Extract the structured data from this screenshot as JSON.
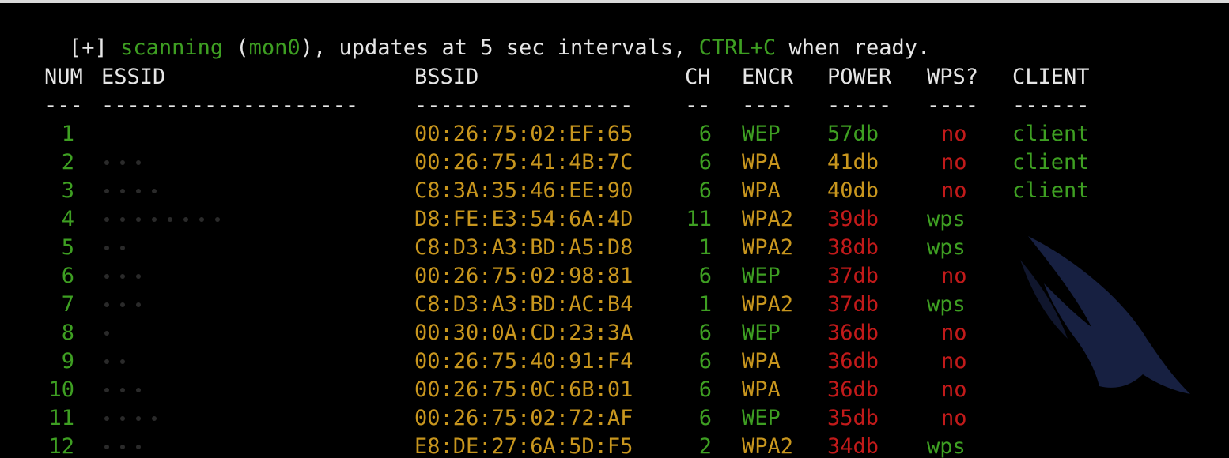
{
  "status_line": {
    "prefix": "[+]",
    "word_scanning": "scanning",
    "iface_open": "(",
    "iface": "mon0",
    "mid": "), updates at 5 sec intervals,",
    "ctrl_c": "CTRL+C",
    "suffix": "when ready."
  },
  "table": {
    "headers": {
      "num": "NUM",
      "essid": "ESSID",
      "bssid": "BSSID",
      "ch": "CH",
      "encr": "ENCR",
      "power": "POWER",
      "wps": "WPS?",
      "client": "CLIENT"
    },
    "separators": {
      "num": "---",
      "essid": "--------------------",
      "bssid": "-----------------",
      "ch": "--",
      "encr": "----",
      "power": "-----",
      "wps": "----",
      "client": "------"
    },
    "rows": [
      {
        "num": "1",
        "bssid": "00:26:75:02:EF:65",
        "ch": "6",
        "encr": "WEP",
        "power": "57db",
        "power_level": "high",
        "wps": "no",
        "client": "client"
      },
      {
        "num": "2",
        "bssid": "00:26:75:41:4B:7C",
        "ch": "6",
        "encr": "WPA",
        "power": "41db",
        "power_level": "mid",
        "wps": "no",
        "client": "client"
      },
      {
        "num": "3",
        "bssid": "C8:3A:35:46:EE:90",
        "ch": "6",
        "encr": "WPA",
        "power": "40db",
        "power_level": "mid",
        "wps": "no",
        "client": "client"
      },
      {
        "num": "4",
        "bssid": "D8:FE:E3:54:6A:4D",
        "ch": "11",
        "encr": "WPA2",
        "power": "39db",
        "power_level": "low",
        "wps": "wps",
        "client": ""
      },
      {
        "num": "5",
        "bssid": "C8:D3:A3:BD:A5:D8",
        "ch": "1",
        "encr": "WPA2",
        "power": "38db",
        "power_level": "low",
        "wps": "wps",
        "client": ""
      },
      {
        "num": "6",
        "bssid": "00:26:75:02:98:81",
        "ch": "6",
        "encr": "WEP",
        "power": "37db",
        "power_level": "low",
        "wps": "no",
        "client": ""
      },
      {
        "num": "7",
        "bssid": "C8:D3:A3:BD:AC:B4",
        "ch": "1",
        "encr": "WPA2",
        "power": "37db",
        "power_level": "low",
        "wps": "wps",
        "client": ""
      },
      {
        "num": "8",
        "bssid": "00:30:0A:CD:23:3A",
        "ch": "6",
        "encr": "WEP",
        "power": "36db",
        "power_level": "low",
        "wps": "no",
        "client": ""
      },
      {
        "num": "9",
        "bssid": "00:26:75:40:91:F4",
        "ch": "6",
        "encr": "WPA",
        "power": "36db",
        "power_level": "low",
        "wps": "no",
        "client": ""
      },
      {
        "num": "10",
        "bssid": "00:26:75:0C:6B:01",
        "ch": "6",
        "encr": "WPA",
        "power": "36db",
        "power_level": "low",
        "wps": "no",
        "client": ""
      },
      {
        "num": "11",
        "bssid": "00:26:75:02:72:AF",
        "ch": "6",
        "encr": "WEP",
        "power": "35db",
        "power_level": "low",
        "wps": "no",
        "client": ""
      },
      {
        "num": "12",
        "bssid": "E8:DE:27:6A:5D:F5",
        "ch": "2",
        "encr": "WPA2",
        "power": "34db",
        "power_level": "low",
        "wps": "wps",
        "client": ""
      }
    ]
  },
  "colors": {
    "green": "#3e9f22",
    "yellow": "#c8961e",
    "red": "#c21a1a",
    "white": "#e6e6e6",
    "background": "#000000"
  },
  "watermark_icon": "kali-dragon-icon"
}
